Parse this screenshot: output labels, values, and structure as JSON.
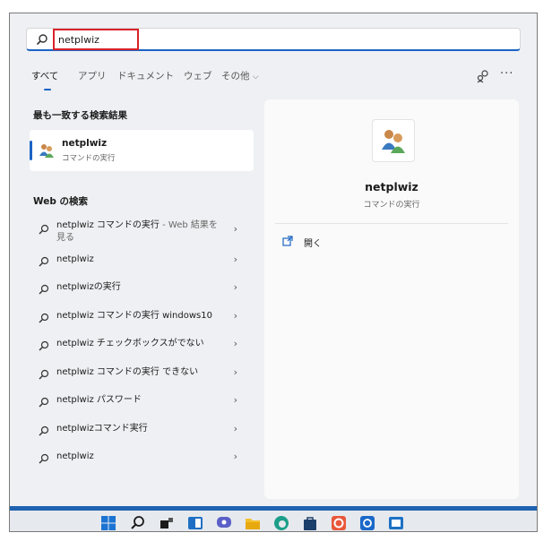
{
  "search": {
    "query": "netplwiz"
  },
  "tabs": [
    {
      "label": "すべて"
    },
    {
      "label": "アプリ"
    },
    {
      "label": "ドキュメント"
    },
    {
      "label": "ウェブ"
    },
    {
      "label": "その他"
    }
  ],
  "tool_icons": [
    "account-icon",
    "more-icon"
  ],
  "more_label": "···",
  "best_match": {
    "heading": "最も一致する検索結果",
    "title": "netplwiz",
    "subtitle": "コマンドの実行"
  },
  "web": {
    "heading": "Web の検索",
    "items": [
      {
        "text": "netplwiz コマンドの実行",
        "sub": " - Web 結果を",
        "sub2": "見る"
      },
      {
        "text": "netplwiz"
      },
      {
        "text": "netplwizの実行"
      },
      {
        "text": "netplwiz コマンドの実行 windows10"
      },
      {
        "text": "netplwiz チェックボックスがでない"
      },
      {
        "text": "netplwiz コマンドの実行 できない"
      },
      {
        "text": "netplwiz パスワード"
      },
      {
        "text": "netplwizコマンド実行"
      },
      {
        "text": "netplwiz"
      }
    ]
  },
  "detail": {
    "title": "netplwiz",
    "subtitle": "コマンドの実行",
    "open_label": "開く"
  },
  "chevron": "›",
  "dropdown_glyph": "⌵",
  "taskbar": [
    "start-icon",
    "search-icon",
    "task-view-icon",
    "widgets-icon",
    "chat-icon",
    "file-explorer-icon",
    "edge-icon",
    "store-icon",
    "office-icon",
    "mail-icon",
    "photos-icon"
  ],
  "colors": {
    "accent": "#1b63c5",
    "highlight": "#d8232a",
    "taskbar_band": "#1e62b0"
  }
}
